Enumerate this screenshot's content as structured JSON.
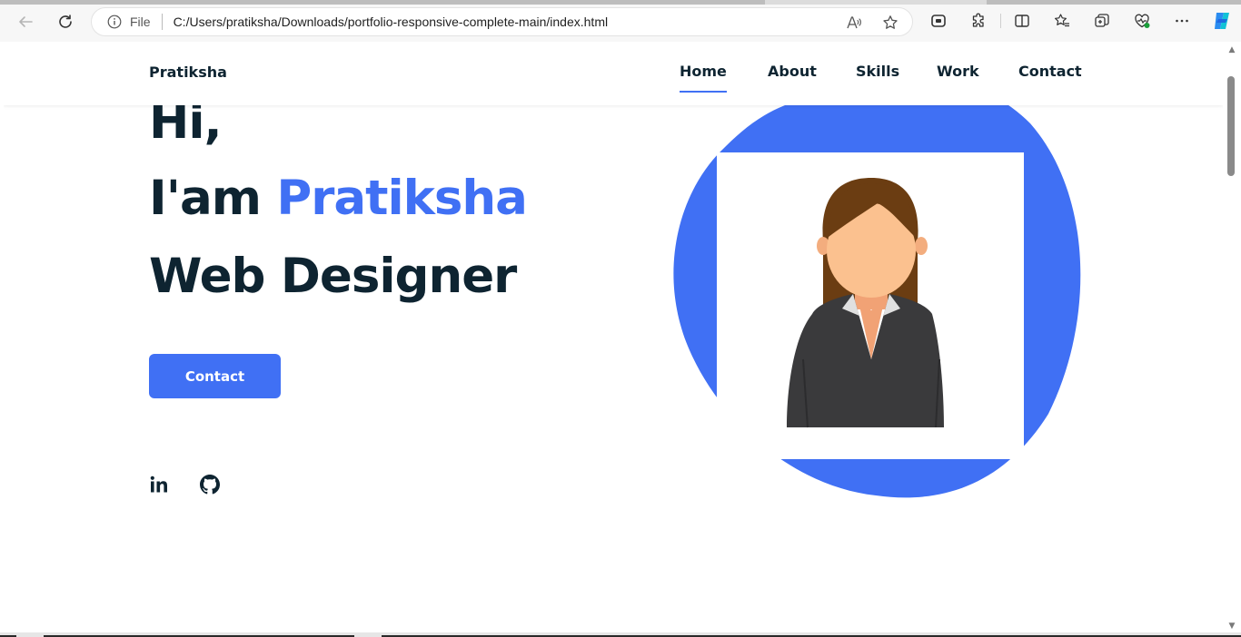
{
  "browser": {
    "file_label": "File",
    "url": "C:/Users/pratiksha/Downloads/portfolio-responsive-complete-main/index.html"
  },
  "site": {
    "brand": "Pratiksha",
    "nav": [
      {
        "label": "Home",
        "active": true
      },
      {
        "label": "About",
        "active": false
      },
      {
        "label": "Skills",
        "active": false
      },
      {
        "label": "Work",
        "active": false
      },
      {
        "label": "Contact",
        "active": false
      }
    ]
  },
  "hero": {
    "greeting": "Hi,",
    "intro_prefix": "I'am",
    "name": "Pratiksha",
    "role": "Web Designer",
    "cta_label": "Contact"
  },
  "social": {
    "icons": [
      "linkedin-icon",
      "github-icon"
    ]
  },
  "colors": {
    "accent": "#4070f4",
    "title": "#0e2431"
  }
}
